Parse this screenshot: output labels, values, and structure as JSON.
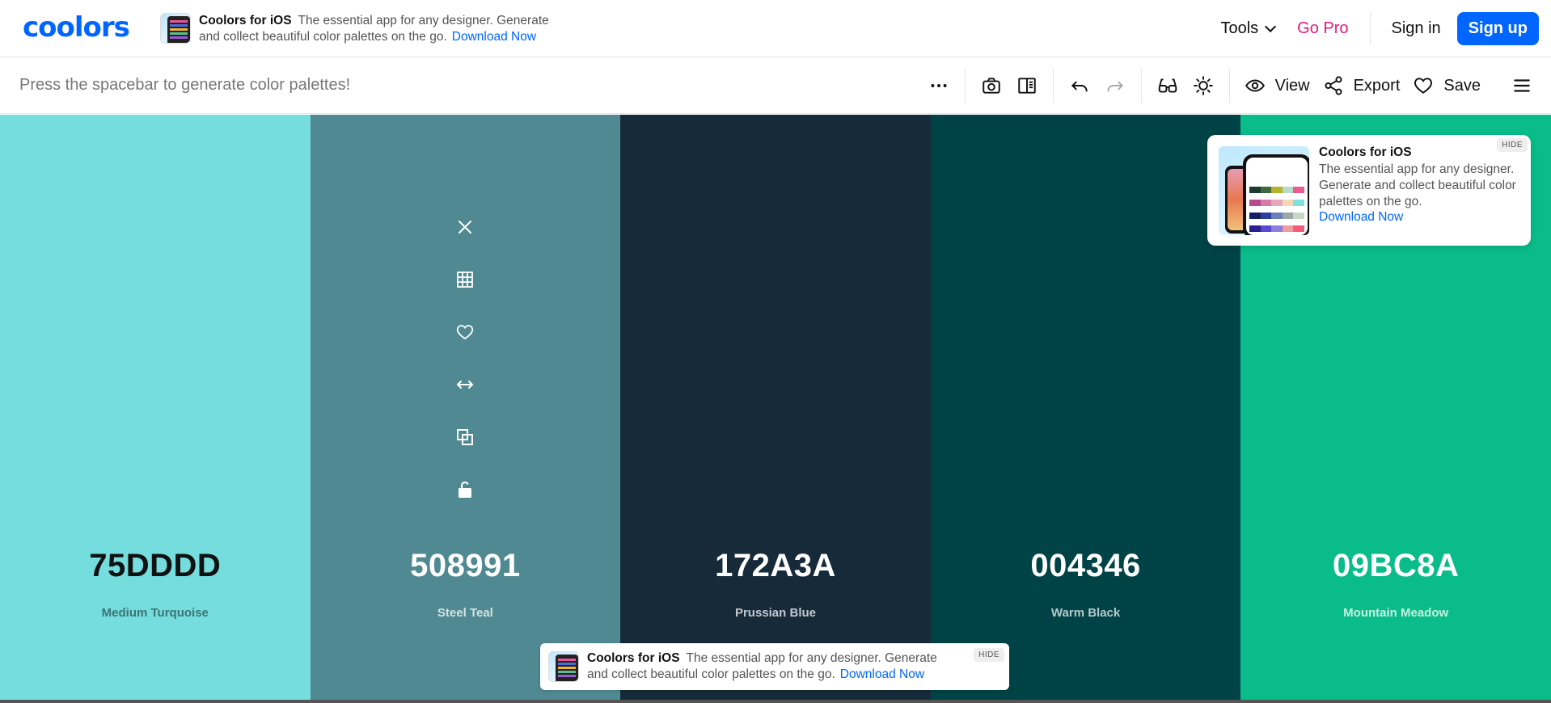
{
  "brand": {
    "logo": "coolors",
    "primary": "#0066ff",
    "pro_color": "#e6197c"
  },
  "top_promo": {
    "title": "Coolors for iOS",
    "text": "The essential app for any designer. Generate and collect beautiful color palettes on the go.",
    "link": "Download Now"
  },
  "nav": {
    "tools": "Tools",
    "go_pro": "Go Pro",
    "sign_in": "Sign in",
    "sign_up": "Sign up"
  },
  "toolbar": {
    "hint": "Press the spacebar to generate color palettes!",
    "view": "View",
    "export": "Export",
    "save": "Save",
    "icons": [
      "more-icon",
      "camera-icon",
      "split-view-icon",
      "undo-icon",
      "redo-icon",
      "glasses-icon",
      "brightness-icon",
      "eye-icon",
      "share-icon",
      "heart-icon",
      "menu-icon"
    ]
  },
  "palette": [
    {
      "hex": "75DDDD",
      "name": "Medium Turquoise",
      "bg": "#75DDDD",
      "fg": "#111111",
      "sub": "#3b7474"
    },
    {
      "hex": "508991",
      "name": "Steel Teal",
      "bg": "#508991",
      "fg": "#ffffff",
      "sub": "#d3e3e5"
    },
    {
      "hex": "172A3A",
      "name": "Prussian Blue",
      "bg": "#172A3A",
      "fg": "#ffffff",
      "sub": "#c2c9cf"
    },
    {
      "hex": "004346",
      "name": "Warm Black",
      "bg": "#004346",
      "fg": "#ffffff",
      "sub": "#b6c9ca"
    },
    {
      "hex": "09BC8A",
      "name": "Mountain Meadow",
      "bg": "#09BC8A",
      "fg": "#ffffff",
      "sub": "#c6f0e3"
    }
  ],
  "swatch_tools": [
    "close-icon",
    "shades-icon",
    "heart-icon",
    "drag-icon",
    "copy-icon",
    "lock-icon"
  ],
  "card_promo": {
    "title": "Coolors for iOS",
    "text": "The essential app for any designer. Generate and collect beautiful color palettes on the go.",
    "link": "Download Now",
    "hide": "HIDE"
  },
  "bottom_promo": {
    "title": "Coolors for iOS",
    "text": "The essential app for any designer. Generate and collect beautiful color palettes on the go.",
    "link": "Download Now",
    "hide": "HIDE"
  }
}
